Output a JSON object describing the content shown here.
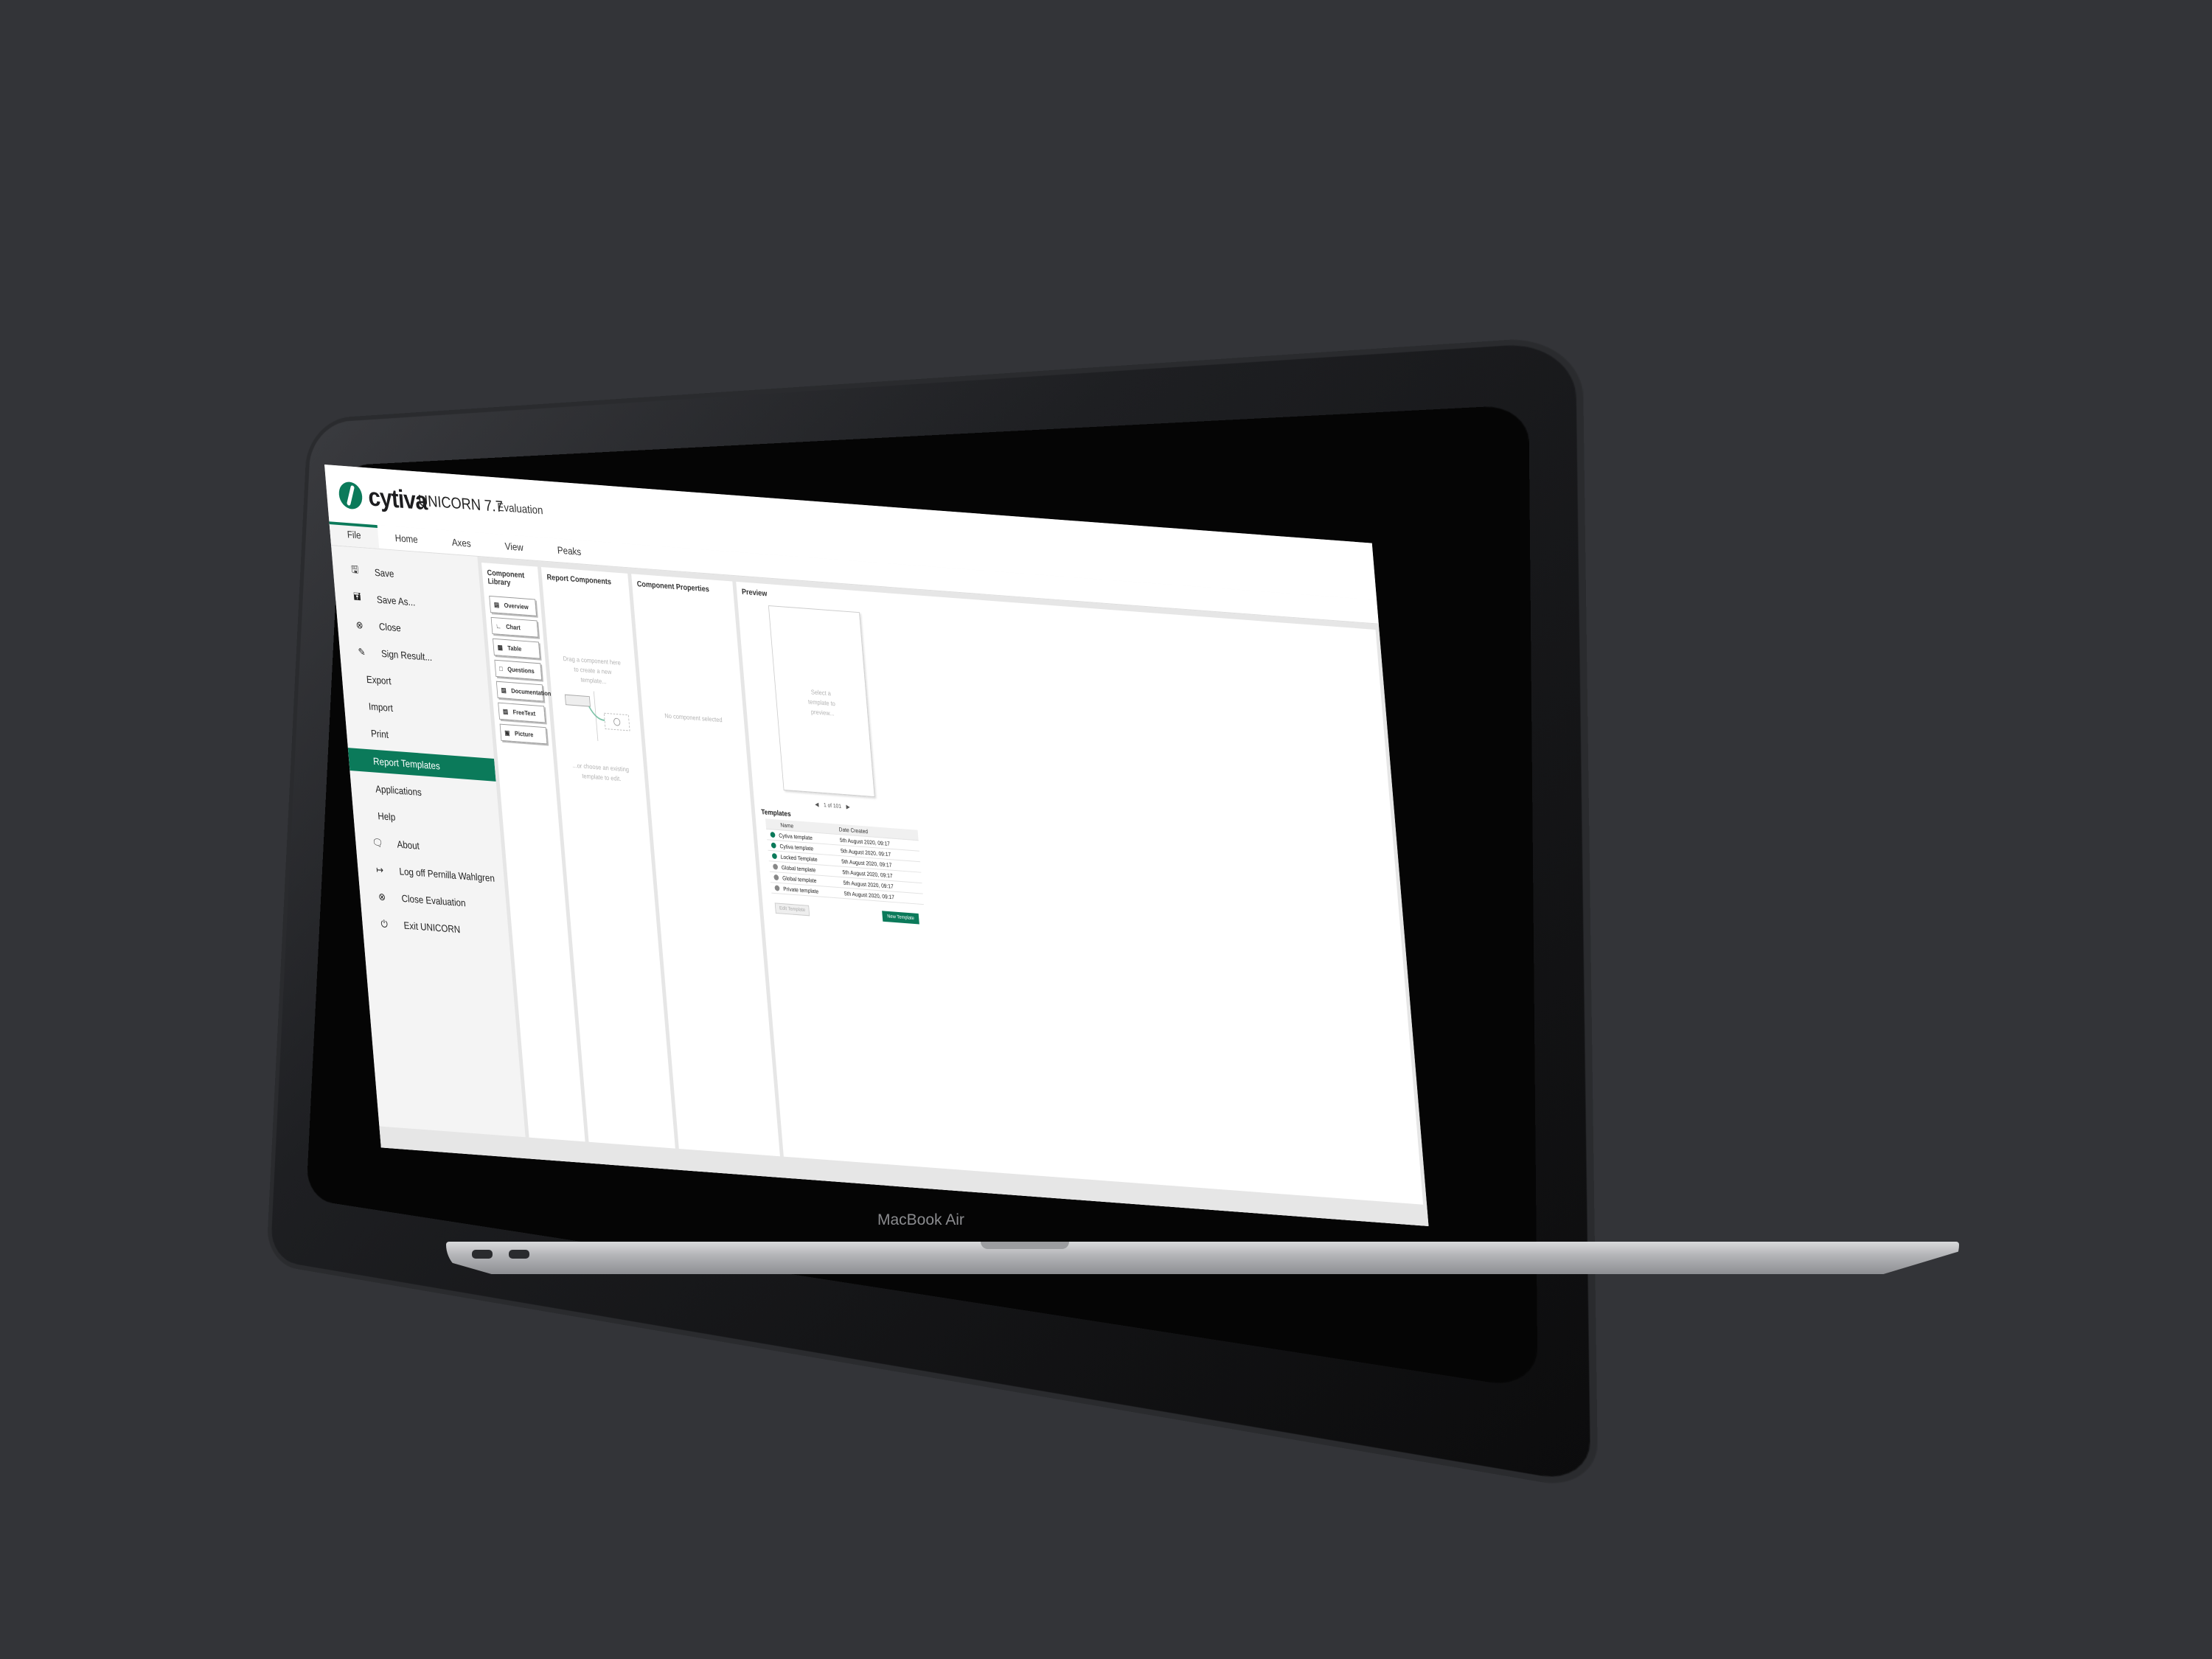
{
  "laptop": {
    "model_label": "MacBook Air"
  },
  "app": {
    "brand": "cytiva",
    "title": "UNICORN 7.7",
    "mode": "Evaluation"
  },
  "ribbon": {
    "tabs": [
      "File",
      "Home",
      "Axes",
      "View",
      "Peaks"
    ],
    "active": "File"
  },
  "file_menu": {
    "items": [
      {
        "label": "Save",
        "icon": "save-icon"
      },
      {
        "label": "Save As...",
        "icon": "save-as-icon"
      },
      {
        "label": "Close",
        "icon": "close-circle-icon"
      },
      {
        "label": "Sign Result...",
        "icon": "sign-icon"
      },
      {
        "label": "Export",
        "icon": ""
      },
      {
        "label": "Import",
        "icon": ""
      },
      {
        "label": "Print",
        "icon": ""
      },
      {
        "label": "Report Templates",
        "icon": "",
        "selected": true
      },
      {
        "label": "Applications",
        "icon": ""
      },
      {
        "label": "Help",
        "icon": ""
      },
      {
        "label": "About",
        "icon": "info-icon"
      },
      {
        "label": "Log off Pernilla Wahlgren",
        "icon": "logout-icon"
      },
      {
        "label": "Close Evaluation",
        "icon": "close-circle-icon"
      },
      {
        "label": "Exit UNICORN",
        "icon": "power-icon"
      }
    ]
  },
  "component_library": {
    "title": "Component Library",
    "items": [
      "Overview",
      "Chart",
      "Table",
      "Questions",
      "Documentation",
      "FreeText",
      "Picture"
    ]
  },
  "report_components": {
    "title": "Report Components",
    "hint_top": "Drag a component here to create a new template...",
    "hint_bottom": "...or choose an existing template to edit."
  },
  "component_properties": {
    "title": "Component Properties",
    "empty": "No component selected"
  },
  "preview": {
    "title": "Preview",
    "placeholder": "Select a template to preview...",
    "pager": "1 of 101"
  },
  "templates": {
    "title": "Templates",
    "columns": [
      "Name",
      "Date Created"
    ],
    "rows": [
      {
        "name": "Cytiva template",
        "date": "5th August 2020, 09:17"
      },
      {
        "name": "Cytiva template",
        "date": "5th August 2020, 09:17"
      },
      {
        "name": "Locked Template",
        "date": "5th August 2020, 09:17"
      },
      {
        "name": "Global template",
        "date": "5th August 2020, 09:17"
      },
      {
        "name": "Global template",
        "date": "5th August 2020, 09:17"
      },
      {
        "name": "Private template",
        "date": "5th August 2020, 09:17"
      }
    ],
    "edit_button": "Edit Template",
    "new_button": "New Template"
  },
  "colors": {
    "accent": "#0b7a5a",
    "background": "#333438"
  }
}
